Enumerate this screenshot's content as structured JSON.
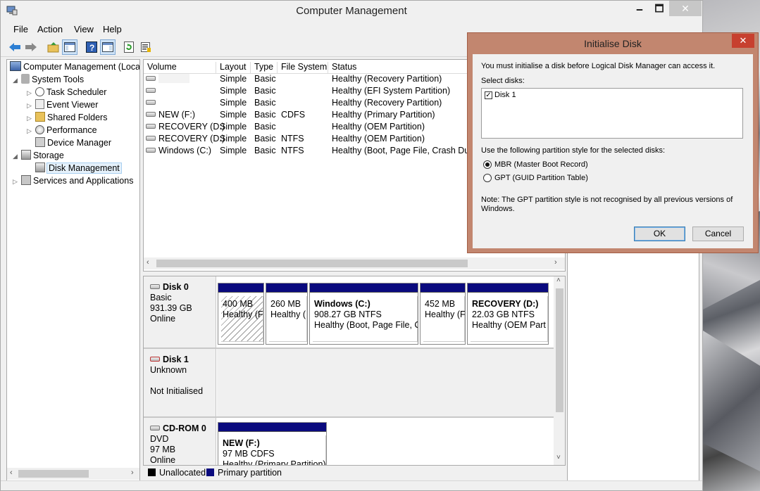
{
  "window": {
    "title": "Computer Management",
    "min_label": "🗕",
    "max_label": "🗖",
    "close_label": "✕"
  },
  "menu": [
    "File",
    "Action",
    "View",
    "Help"
  ],
  "tree": {
    "root": "Computer Management (Local",
    "system_tools": "System Tools",
    "task_scheduler": "Task Scheduler",
    "event_viewer": "Event Viewer",
    "shared_folders": "Shared Folders",
    "performance": "Performance",
    "device_manager": "Device Manager",
    "storage": "Storage",
    "disk_management": "Disk Management",
    "services": "Services and Applications"
  },
  "volumes": {
    "headers": [
      "Volume",
      "Layout",
      "Type",
      "File System",
      "Status"
    ],
    "rows": [
      [
        "",
        "Simple",
        "Basic",
        "",
        "Healthy (Recovery Partition)"
      ],
      [
        "",
        "Simple",
        "Basic",
        "",
        "Healthy (EFI System Partition)"
      ],
      [
        "",
        "Simple",
        "Basic",
        "",
        "Healthy (Recovery Partition)"
      ],
      [
        "NEW (F:)",
        "Simple",
        "Basic",
        "CDFS",
        "Healthy (Primary Partition)"
      ],
      [
        "RECOVERY (D:)",
        "Simple",
        "Basic",
        "",
        "Healthy (OEM Partition)"
      ],
      [
        "RECOVERY (D:)",
        "Simple",
        "Basic",
        "NTFS",
        "Healthy (OEM Partition)"
      ],
      [
        "Windows (C:)",
        "Simple",
        "Basic",
        "NTFS",
        "Healthy (Boot, Page File, Crash Dump"
      ]
    ]
  },
  "disks": {
    "disk0": {
      "name": "Disk 0",
      "type": "Basic",
      "size": "931.39 GB",
      "status": "Online"
    },
    "disk1": {
      "name": "Disk 1",
      "type": "Unknown",
      "status": "Not Initialised"
    },
    "cdrom": {
      "name": "CD-ROM 0",
      "type": "DVD",
      "size": "97 MB",
      "status": "Online"
    }
  },
  "partitions": {
    "p1": {
      "size": "400 MB",
      "status": "Healthy (F"
    },
    "p2": {
      "size": "260 MB",
      "status": "Healthy ("
    },
    "p3": {
      "name": "Windows  (C:)",
      "size": "908.27 GB NTFS",
      "status": "Healthy (Boot, Page File, C"
    },
    "p4": {
      "size": "452 MB",
      "status": "Healthy (F"
    },
    "p5": {
      "name": "RECOVERY  (D:)",
      "size": "22.03 GB NTFS",
      "status": "Healthy (OEM Part"
    },
    "cd": {
      "name": "NEW  (F:)",
      "size": "97 MB CDFS",
      "status": "Healthy (Primary Partition)"
    }
  },
  "legend": {
    "unallocated": "Unallocated",
    "primary": "Primary partition"
  },
  "colors": {
    "primary_partition": "#0a0a7e",
    "unallocated": "#000000",
    "dialog_frame": "#c2866f"
  },
  "dialog": {
    "title": "Initialise Disk",
    "close_label": "✕",
    "intro": "You must initialise a disk before Logical Disk Manager can access it.",
    "select_label": "Select disks:",
    "disk_item": "Disk 1",
    "style_label": "Use the following partition style for the selected disks:",
    "mbr": "MBR (Master Boot Record)",
    "gpt": "GPT (GUID Partition Table)",
    "note_line1": "Note: The GPT partition style is not recognised by all previous versions of",
    "note_line2": "Windows.",
    "ok": "OK",
    "cancel": "Cancel"
  }
}
